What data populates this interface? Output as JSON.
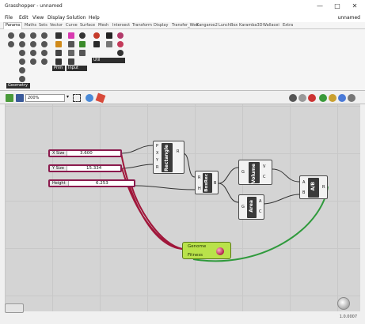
{
  "window": {
    "title": "Grasshopper - unnamed",
    "doc_name": "unnamed",
    "min_glyph": "—",
    "max_glyph": "□",
    "close_glyph": "✕"
  },
  "menu": [
    "File",
    "Edit",
    "View",
    "Display",
    "Solution",
    "Help"
  ],
  "tabs": [
    "Params",
    "Maths",
    "Sets",
    "Vector",
    "Curve",
    "Surface",
    "Mesh",
    "Intersect",
    "Transform",
    "Display",
    "Transfer_Wed",
    "Kangaroo2",
    "LunchBox",
    "Karamba3D",
    "Wallacei",
    "Extra"
  ],
  "ribbon": {
    "panels": [
      "Geometry",
      "Prim",
      "Input",
      "Util"
    ]
  },
  "toolbar": {
    "zoom": "200%"
  },
  "sliders": [
    {
      "label": "X Size",
      "value": "3.600"
    },
    {
      "label": "Y Size",
      "value": "15.334"
    },
    {
      "label": "Height",
      "value": "6.253"
    }
  ],
  "components": {
    "rectangle": {
      "name": "Rectangle",
      "inputs": [
        "P",
        "X",
        "Y",
        "R"
      ],
      "outputs": [
        "R"
      ]
    },
    "boxrec": {
      "name": "BoxRec",
      "inputs": [
        "R",
        "H"
      ],
      "outputs": [
        "B"
      ]
    },
    "volume": {
      "name": "Volume",
      "inputs": [
        "G"
      ],
      "outputs": [
        "V",
        "C"
      ]
    },
    "area": {
      "name": "Area",
      "inputs": [
        "G"
      ],
      "outputs": [
        "A",
        "C"
      ]
    },
    "ab": {
      "name": "A/B",
      "inputs": [
        "A",
        "B"
      ],
      "outputs": [
        "R"
      ]
    }
  },
  "genome": {
    "label": "Genome",
    "fitness": "Fitness"
  },
  "status": {
    "version": "1.0.0007"
  },
  "colors": {
    "slider_border": "#8b1a4d",
    "wire_red": "#a0163a",
    "wire_green": "#2f9a3c",
    "genome_fill": "#b9e24a"
  }
}
